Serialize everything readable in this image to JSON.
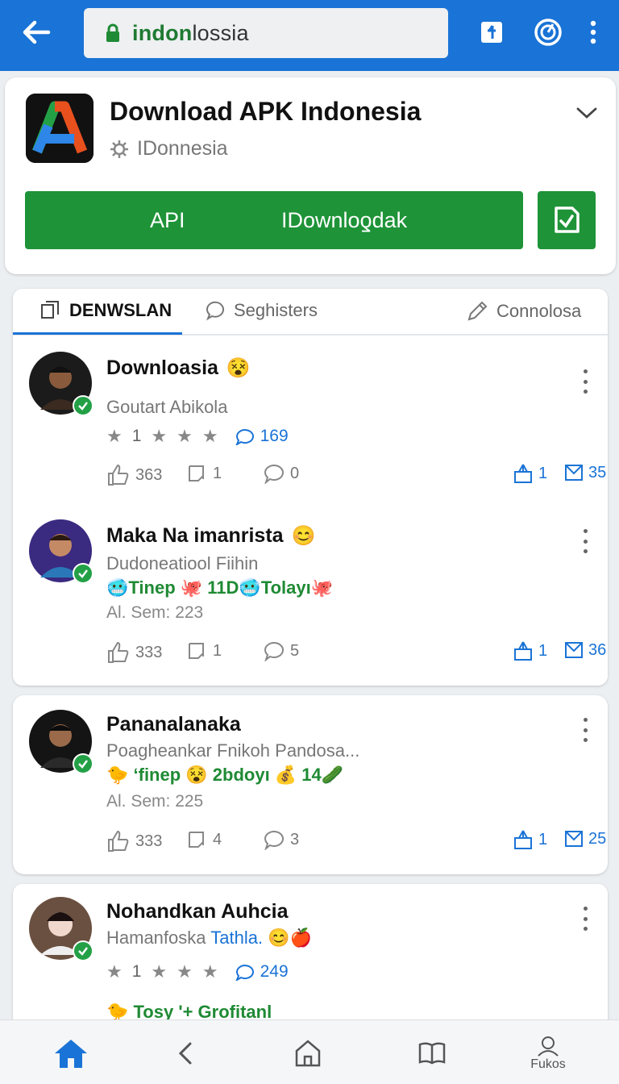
{
  "browser": {
    "url_highlight": "indon",
    "url_rest": "lossia"
  },
  "app": {
    "title": "Download APK Indonesia",
    "subtitle": "IDonnesia",
    "button_label_left": "API",
    "button_label_right": "IDownloƍdak"
  },
  "tabs": [
    {
      "label": "DENWSLAN"
    },
    {
      "label": "Seghisters"
    },
    {
      "label": "Connolosa"
    }
  ],
  "posts": [
    {
      "name": "Downloasia",
      "subtitle": "Goutart Abikola",
      "stars": "1",
      "blue_count": "169",
      "likes": "363",
      "shares": "1",
      "comments": "0",
      "right_a": "1",
      "right_b": "35"
    },
    {
      "name": "Maka Na imanrista",
      "subtitle": "Dudoneatiool Fiihin",
      "tags": "🥶Tinep 🐙 11D🥶Tolayı🐙",
      "sem": "Al. Sem: 223",
      "likes": "333",
      "shares": "1",
      "comments": "5",
      "right_a": "1",
      "right_b": "36"
    },
    {
      "name": "Pananalanaka",
      "subtitle": "Poagheankar Fnikoh Pandosa...",
      "tags": "🐤 ʻfinep 😵 2bdoyı 💰 14🥒",
      "sem": "Al. Sem: 225",
      "likes": "333",
      "shares": "4",
      "comments": "3",
      "right_a": "1",
      "right_b": "25"
    },
    {
      "name": "Nohandkan Auhcia",
      "subtitle_a": "Hamanfoska",
      "subtitle_b": "Tathla.",
      "stars": "1",
      "blue_count": "249",
      "tags": "🐤 Tosy '+ Grofitanl"
    }
  ],
  "bottom_nav": {
    "last_label": "Fukos"
  },
  "colors": {
    "accent": "#1a73d6",
    "green": "#1e9338"
  }
}
